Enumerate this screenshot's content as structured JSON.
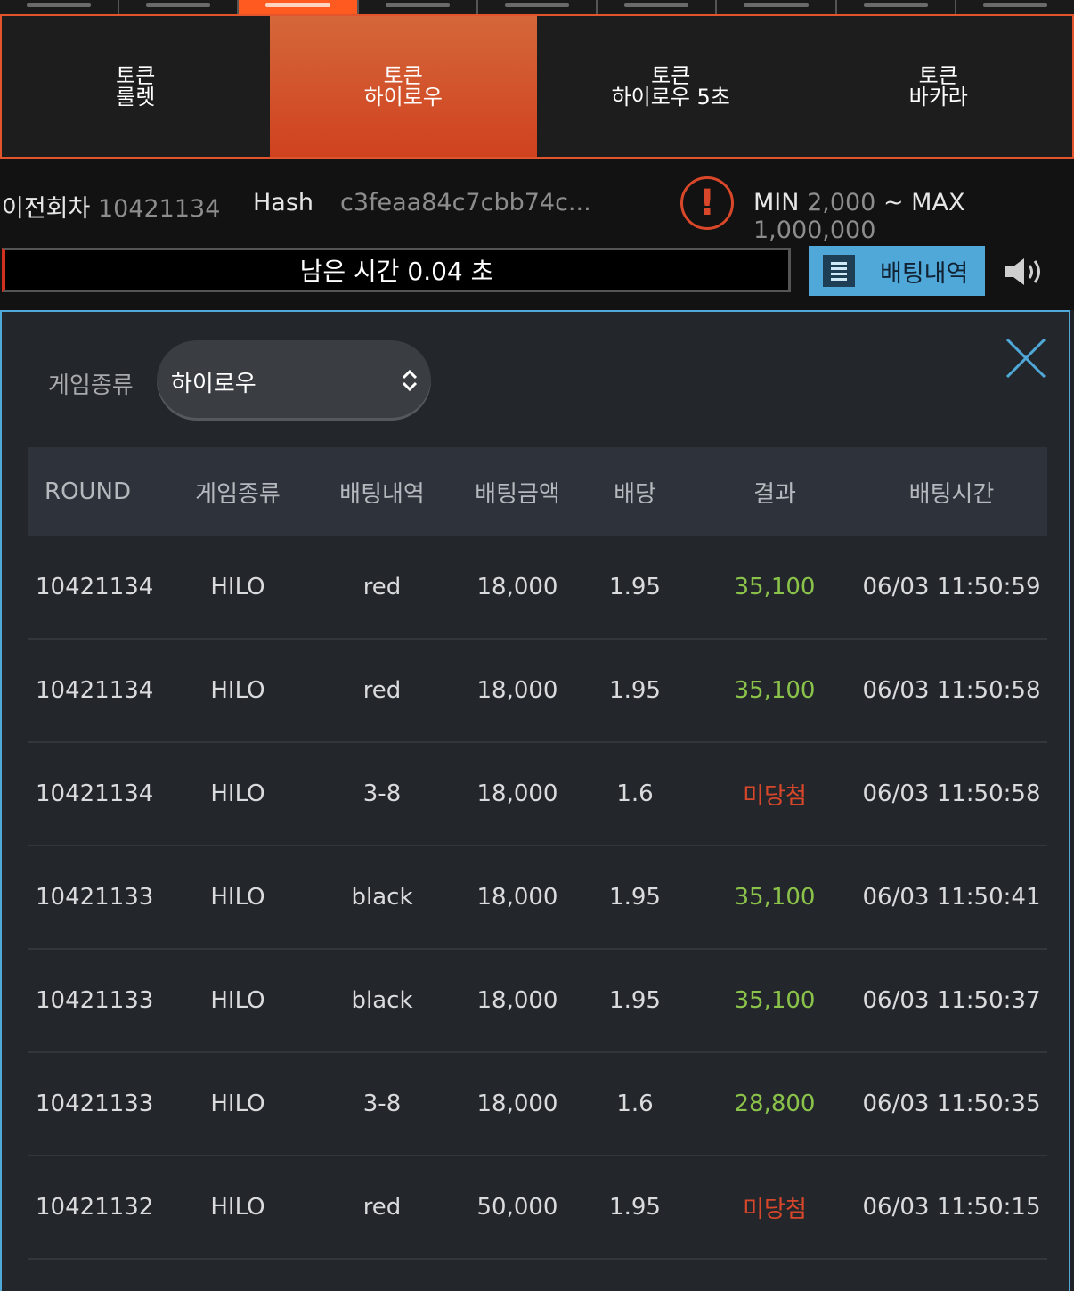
{
  "game_tabs": [
    {
      "line1": "토큰",
      "line2": "룰렛",
      "active": false
    },
    {
      "line1": "토큰",
      "line2": "하이로우",
      "active": true
    },
    {
      "line1": "토큰",
      "line2": "하이로우 5초",
      "active": false
    },
    {
      "line1": "토큰",
      "line2": "바카라",
      "active": false
    }
  ],
  "info": {
    "prev_round_label": "이전회차",
    "prev_round_value": "10421134",
    "hash_label": "Hash",
    "hash_value": "c3feaa84c7cbb74c...",
    "min_label": "MIN",
    "min_value": "2,000",
    "tilde": "~",
    "max_label": "MAX",
    "max_value": "1,000,000"
  },
  "timer": {
    "text": "남은 시간 0.04 초"
  },
  "bet_history_button": {
    "label": "배팅내역"
  },
  "filter": {
    "label": "게임종류",
    "selected": "하이로우"
  },
  "table": {
    "headers": [
      "ROUND",
      "게임종류",
      "배팅내역",
      "배팅금액",
      "배당",
      "결과",
      "배팅시간"
    ],
    "rows": [
      {
        "round": "10421134",
        "game": "HILO",
        "bet": "red",
        "amount": "18,000",
        "odds": "1.95",
        "result": "35,100",
        "status": "win",
        "time": "06/03 11:50:59"
      },
      {
        "round": "10421134",
        "game": "HILO",
        "bet": "red",
        "amount": "18,000",
        "odds": "1.95",
        "result": "35,100",
        "status": "win",
        "time": "06/03 11:50:58"
      },
      {
        "round": "10421134",
        "game": "HILO",
        "bet": "3-8",
        "amount": "18,000",
        "odds": "1.6",
        "result": "미당첨",
        "status": "lose",
        "time": "06/03 11:50:58"
      },
      {
        "round": "10421133",
        "game": "HILO",
        "bet": "black",
        "amount": "18,000",
        "odds": "1.95",
        "result": "35,100",
        "status": "win",
        "time": "06/03 11:50:41"
      },
      {
        "round": "10421133",
        "game": "HILO",
        "bet": "black",
        "amount": "18,000",
        "odds": "1.95",
        "result": "35,100",
        "status": "win",
        "time": "06/03 11:50:37"
      },
      {
        "round": "10421133",
        "game": "HILO",
        "bet": "3-8",
        "amount": "18,000",
        "odds": "1.6",
        "result": "28,800",
        "status": "win",
        "time": "06/03 11:50:35"
      },
      {
        "round": "10421132",
        "game": "HILO",
        "bet": "red",
        "amount": "50,000",
        "odds": "1.95",
        "result": "미당첨",
        "status": "lose",
        "time": "06/03 11:50:15"
      }
    ]
  },
  "colors": {
    "accent": "#e2542b",
    "win": "#8bc34a",
    "lose": "#d9472a",
    "button": "#4fa8d8"
  }
}
